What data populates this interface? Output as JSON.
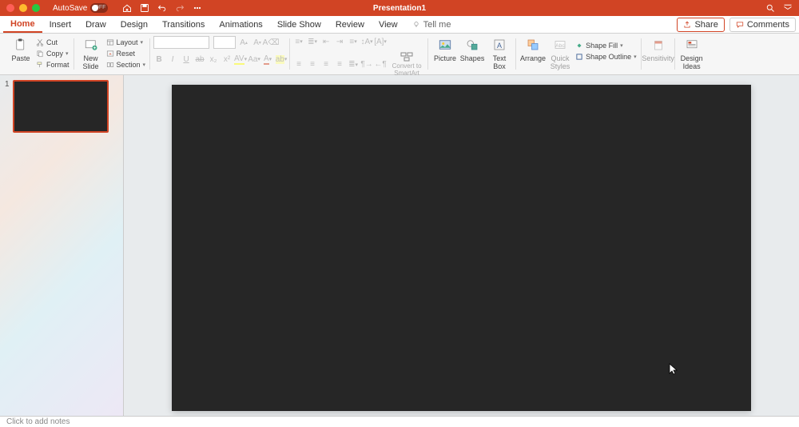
{
  "titlebar": {
    "autosave_label": "AutoSave",
    "autosave_state": "OFF",
    "title": "Presentation1"
  },
  "tabs": [
    "Home",
    "Insert",
    "Draw",
    "Design",
    "Transitions",
    "Animations",
    "Slide Show",
    "Review",
    "View"
  ],
  "tellme": "Tell me",
  "share": "Share",
  "comments": "Comments",
  "ribbon": {
    "paste": "Paste",
    "cut": "Cut",
    "copy": "Copy",
    "format": "Format",
    "newslide": "New\nSlide",
    "layout": "Layout",
    "reset": "Reset",
    "section": "Section",
    "convert": "Convert to\nSmartArt",
    "picture": "Picture",
    "shapes": "Shapes",
    "textbox": "Text\nBox",
    "arrange": "Arrange",
    "quickstyles": "Quick\nStyles",
    "shapefill": "Shape Fill",
    "shapeoutline": "Shape Outline",
    "sensitivity": "Sensitivity",
    "designideas": "Design\nIdeas"
  },
  "thumb_num": "1",
  "notes_placeholder": "Click to add notes"
}
